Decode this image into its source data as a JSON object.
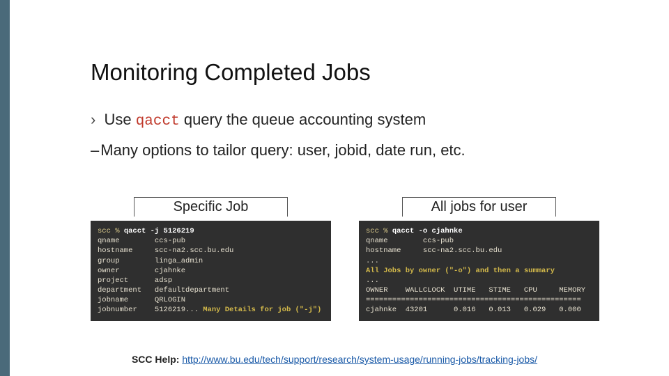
{
  "title": "Monitoring Completed Jobs",
  "bullets": {
    "line1_pre": "Use ",
    "line1_code": "qacct",
    "line1_post": " query the queue accounting system",
    "line2": "Many options to tailor query: user, jobid, date run, etc."
  },
  "left": {
    "header": "Specific Job",
    "prompt": "scc % ",
    "cmd": "qacct -j 5126219",
    "body": "qname        ccs-pub\nhostname     scc-na2.scc.bu.edu\ngroup        linga_admin\nowner        cjahnke\nproject      adsp\ndepartment   defaultdepartment\njobname      QRLOGIN\njobnumber    5126219... ",
    "tail_hl": "Many Details for job (\"-j\")"
  },
  "right": {
    "header": "All jobs for user",
    "prompt": "scc % ",
    "cmd": "qacct -o cjahnke",
    "body1": "qname        ccs-pub\nhostname     scc-na2.scc.bu.edu\n...",
    "hl": "All Jobs by owner (\"-o\") and then a summary",
    "body2": "...\nOWNER    WALLCLOCK  UTIME   STIME   CPU     MEMORY\n=================================================\ncjahnke  43201      0.016   0.013   0.029   0.000"
  },
  "footer": {
    "label": "SCC Help: ",
    "url_text": "http://www.bu.edu/tech/support/research/system-usage/running-jobs/tracking-jobs/"
  }
}
